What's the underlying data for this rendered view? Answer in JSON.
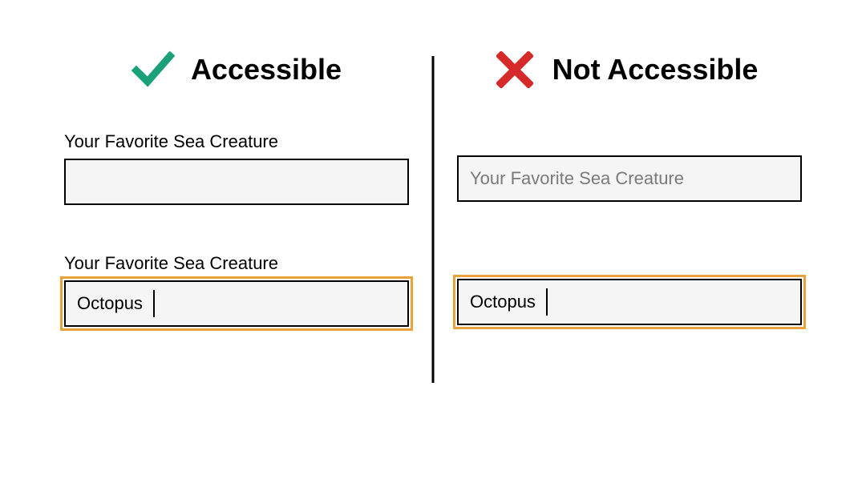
{
  "headers": {
    "accessible": {
      "title": "Accessible",
      "icon": "checkmark-icon"
    },
    "notAccessible": {
      "title": "Not Accessible",
      "icon": "x-icon"
    }
  },
  "labels": {
    "labelAbove": "Your Favorite Sea Creature",
    "placeholder": "Your Favorite Sea Creature"
  },
  "values": {
    "filled": "Octopus"
  },
  "colors": {
    "check": "#1aa179",
    "x": "#d62a2a",
    "focusRing": "#e9a13b",
    "inputBg": "#f5f5f5",
    "placeholder": "#7a7a7a"
  }
}
